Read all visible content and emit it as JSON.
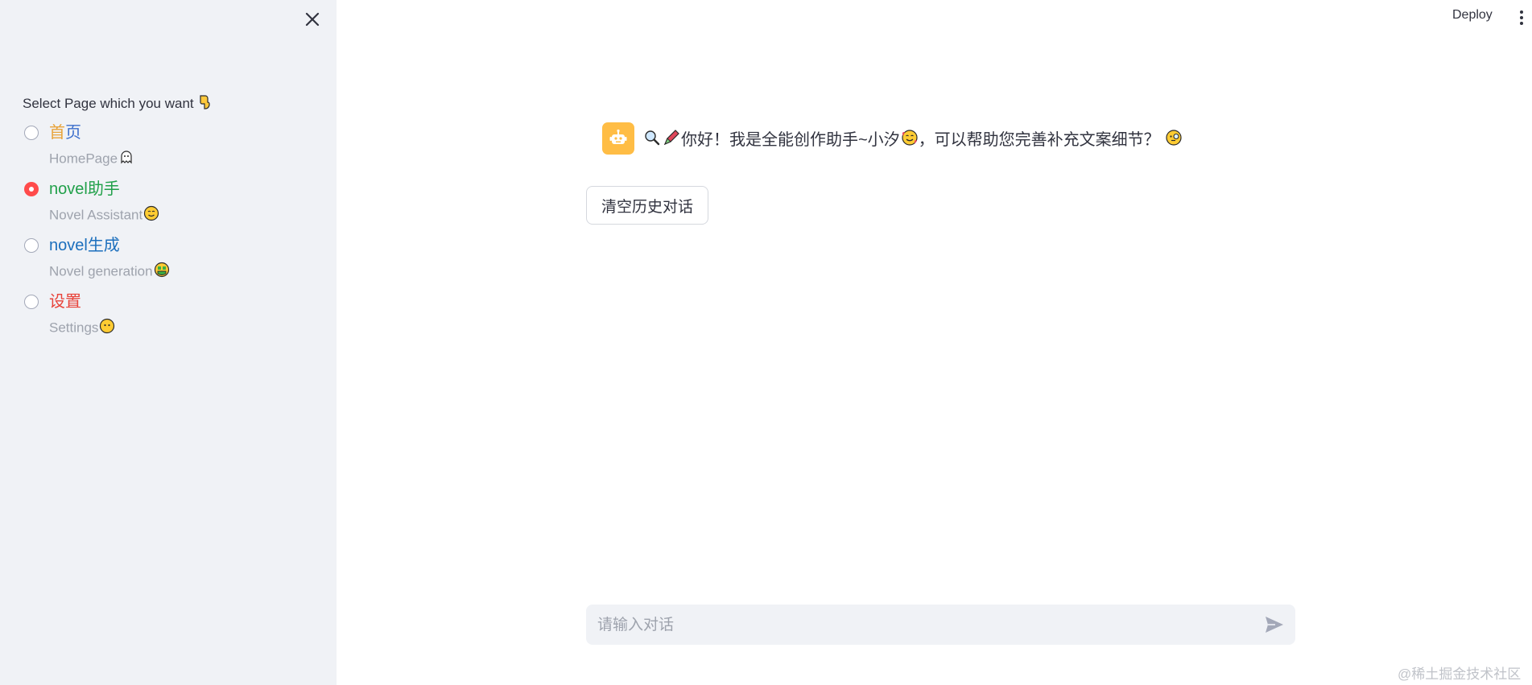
{
  "sidebar": {
    "radio_title": "Select Page which you want",
    "radio_title_icon": "backhand-index-pointing-down-icon",
    "options": [
      {
        "label_part1": "首",
        "label_part2": "页",
        "caption": "HomePage",
        "caption_icon": "ghost-icon",
        "selected": false,
        "color1": "#e8a33a",
        "color2": "#3b6ecc"
      },
      {
        "label": "novel助手",
        "caption": "Novel Assistant",
        "caption_icon": "smiling-face-icon",
        "selected": true,
        "color": "#21a04a"
      },
      {
        "label": "novel生成",
        "caption": "Novel generation",
        "caption_icon": "money-mouth-face-icon",
        "selected": false,
        "color": "#1c6fbd"
      },
      {
        "label": "设置",
        "caption": "Settings",
        "caption_icon": "face-without-mouth-icon",
        "selected": false,
        "color": "#e8433a"
      }
    ]
  },
  "header": {
    "deploy_label": "Deploy",
    "menu_icon": "vertical-dots-icon"
  },
  "chat": {
    "avatar_icon": "robot-icon",
    "message_prefix_icons": [
      "magnifying-glass-icon",
      "pen-icon"
    ],
    "message": "你好！我是全能创作助手~小汐",
    "message_mid_icon": "smiling-face-with-hearts-icon",
    "message_tail": "，可以帮助您完善补充文案细节？",
    "message_end_icon": "face-with-monocle-icon",
    "clear_button": "清空历史对话",
    "input_placeholder": "请输入对话",
    "send_icon": "send-icon"
  },
  "watermark": "@稀土掘金技术社区",
  "colors": {
    "sidebar_bg": "#f0f2f6",
    "accent": "#ff4b4b",
    "avatar_bg": "#ffbd45"
  }
}
